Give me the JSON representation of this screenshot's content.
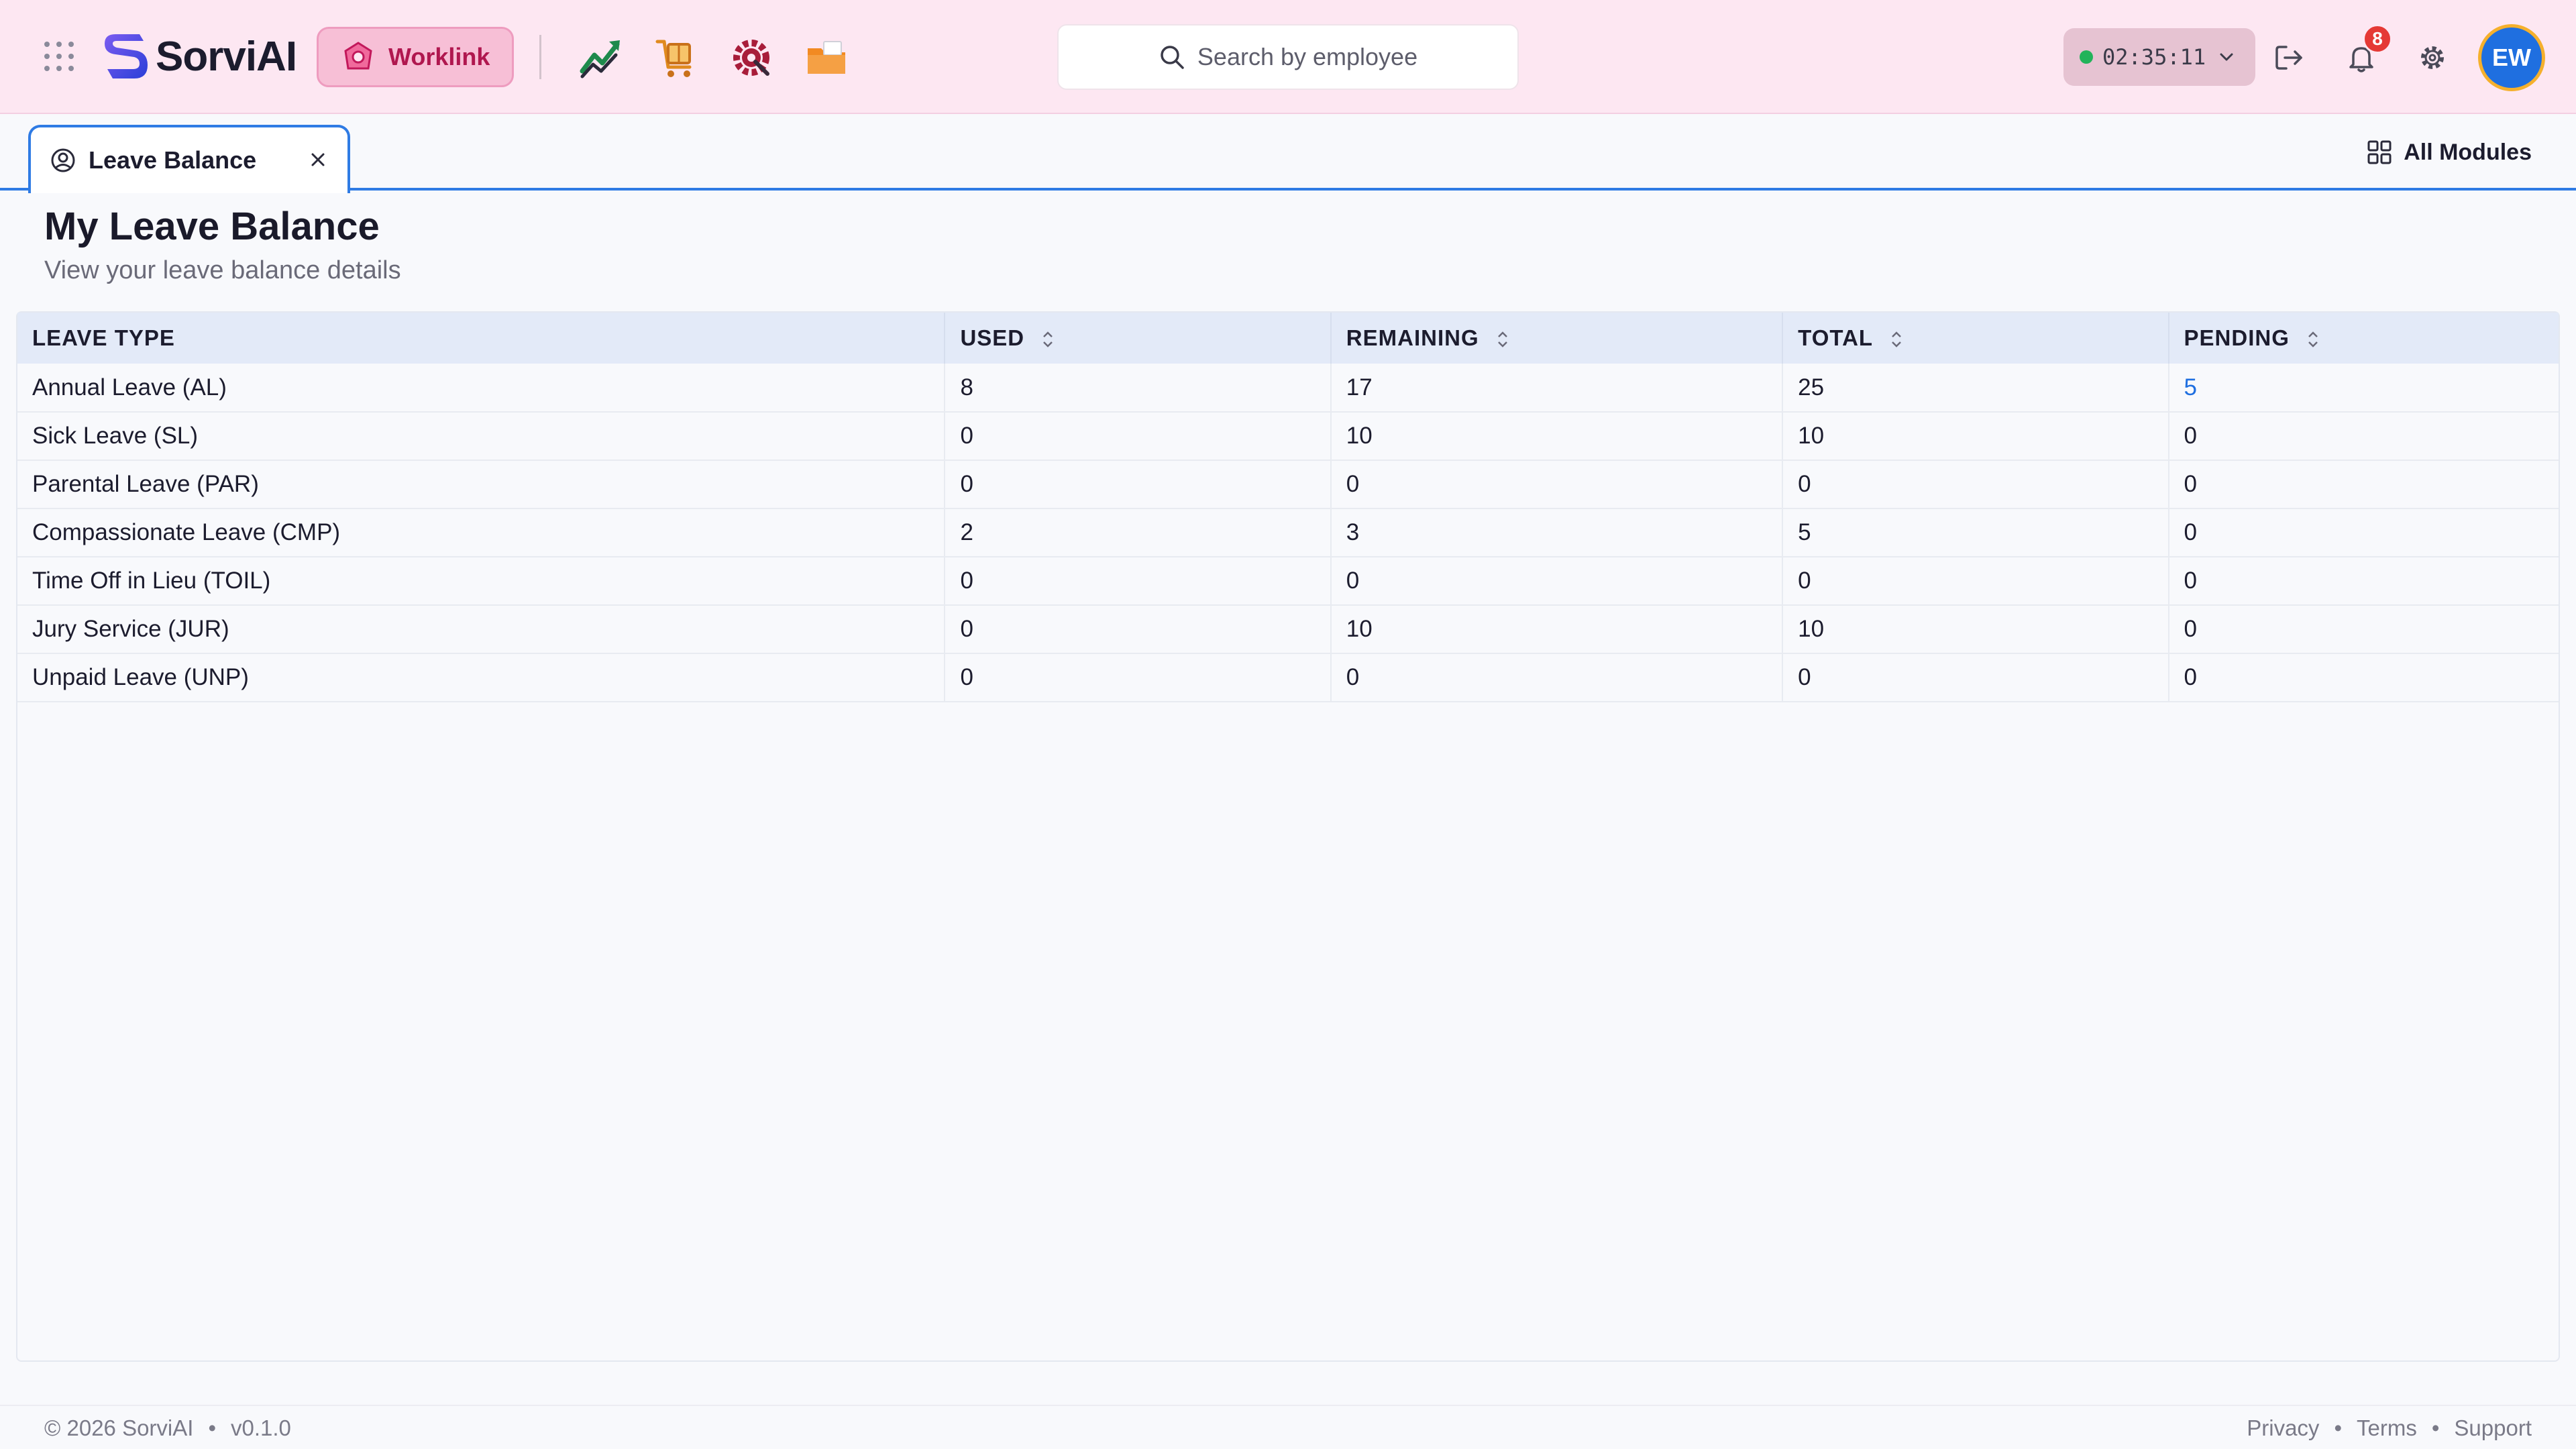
{
  "brand": {
    "name": "SorviAI"
  },
  "module_chip": {
    "label": "Worklink"
  },
  "search": {
    "placeholder": "Search by employee"
  },
  "timer": {
    "time": "02:35:11",
    "status_color": "#22b35a"
  },
  "notifications": {
    "count": "8"
  },
  "user": {
    "initials": "EW"
  },
  "tab": {
    "label": "Leave Balance"
  },
  "all_modules": {
    "label": "All Modules"
  },
  "page": {
    "title": "My Leave Balance",
    "subtitle": "View your leave balance details"
  },
  "table": {
    "headers": [
      "LEAVE TYPE",
      "USED",
      "REMAINING",
      "TOTAL",
      "PENDING"
    ],
    "rows": [
      [
        "Annual Leave (AL)",
        "8",
        "17",
        "25",
        "5"
      ],
      [
        "Sick Leave (SL)",
        "0",
        "10",
        "10",
        "0"
      ],
      [
        "Parental Leave (PAR)",
        "0",
        "0",
        "0",
        "0"
      ],
      [
        "Compassionate Leave (CMP)",
        "2",
        "3",
        "5",
        "0"
      ],
      [
        "Time Off in Lieu (TOIL)",
        "0",
        "0",
        "0",
        "0"
      ],
      [
        "Jury Service (JUR)",
        "0",
        "10",
        "10",
        "0"
      ],
      [
        "Unpaid Leave (UNP)",
        "0",
        "0",
        "0",
        "0"
      ]
    ]
  },
  "footer": {
    "copyright": "© 2026 SorviAI",
    "version": "v0.1.0",
    "links": [
      "Privacy",
      "Terms",
      "Support"
    ]
  },
  "colors": {
    "header_bg": "#fde7f2",
    "accent": "#2f7be4",
    "module_chip": "#f7bfd6",
    "badge": "#e53935",
    "avatar": "#1f6fe0"
  }
}
